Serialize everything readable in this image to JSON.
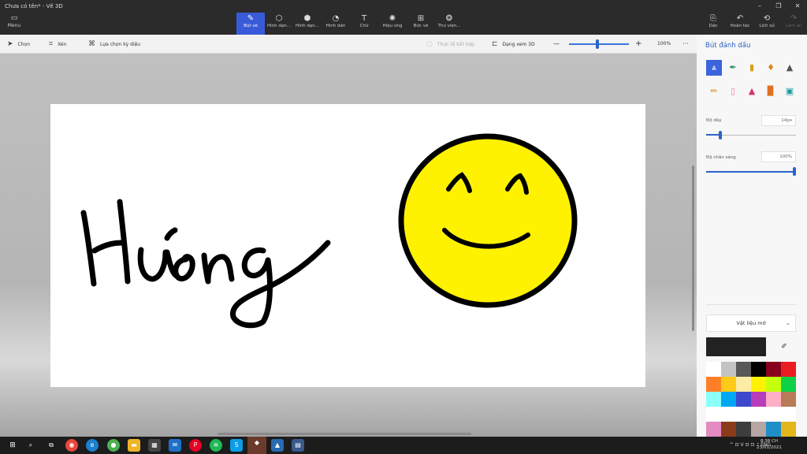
{
  "window": {
    "title": "Chưa có tên* - Vẽ 3D",
    "controls": [
      "–",
      "❐",
      "✕"
    ]
  },
  "menu": {
    "label": "Menu"
  },
  "ribbon": {
    "tools": [
      {
        "label": "Bút vẽ",
        "icon": "brush-icon"
      },
      {
        "label": "Hình dạn...",
        "icon": "2d-shapes-icon"
      },
      {
        "label": "Hình dạn...",
        "icon": "3d-shapes-icon"
      },
      {
        "label": "Hình dán",
        "icon": "stickers-icon"
      },
      {
        "label": "Chữ",
        "icon": "text-icon"
      },
      {
        "label": "Hiệu ứng",
        "icon": "effects-icon"
      },
      {
        "label": "Bức vẽ",
        "icon": "canvas-icon"
      },
      {
        "label": "Thư viện...",
        "icon": "library-icon"
      }
    ],
    "right": [
      {
        "label": "Dán",
        "icon": "paste-icon"
      },
      {
        "label": "Hoàn tác",
        "icon": "undo-icon"
      },
      {
        "label": "Lịch sử",
        "icon": "history-icon"
      },
      {
        "label": "Làm lại",
        "icon": "redo-icon"
      }
    ]
  },
  "subbar": {
    "select": "Chọn",
    "crop": "Xén",
    "magic_select": "Lựa chọn kỳ diệu",
    "mixed_reality": "Thực tế kết hợp",
    "view3d": "Dạng xem 3D",
    "zoom_minus": "—",
    "zoom_plus": "+",
    "zoom": "100%",
    "more": "···"
  },
  "panel": {
    "title": "Bút đánh dấu",
    "thickness_label": "Độ dày",
    "thickness_value": "14px",
    "opacity_label": "Độ chắn sáng",
    "opacity_value": "100%",
    "thickness_fraction": 0.14,
    "opacity_fraction": 1.0,
    "material": "Vật liệu mờ",
    "current_color": "#222222",
    "palette": [
      "#ffffff",
      "#c3c3c3",
      "#585858",
      "#000000",
      "#88001b",
      "#ec1c24",
      "#ff7f27",
      "#ffca18",
      "#fdeca6",
      "#fff200",
      "#c4ff0e",
      "#0ed145",
      "#8cfffb",
      "#00a8f3",
      "#3f48cc",
      "#b83dba",
      "#ffaec8",
      "#b97a56",
      "#ffffff",
      "#ffffff",
      "#ffffff",
      "#ffffff",
      "#ffffff",
      "#ffffff",
      "#e38bc2",
      "#8b3a1a",
      "#3d3d3d",
      "#b5a6a3",
      "#1f8fc8",
      "#e3b61c"
    ]
  },
  "taskbar": {
    "tray_text": "^ ⊡ V ⊡ ⊡ ♪ ENG",
    "time": "8:38 CH",
    "date": "23/01/2021"
  }
}
